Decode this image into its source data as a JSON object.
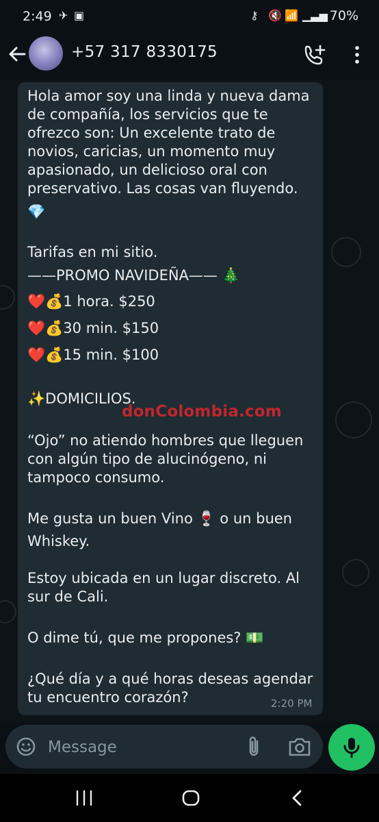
{
  "status_bar": {
    "time": "2:49",
    "battery": "70%"
  },
  "header": {
    "contact_name": "+57 317 8330175"
  },
  "message": {
    "lines": [
      "Hola amor soy una linda y nueva dama",
      "de compañía, los servicios que te",
      "ofrezco son: Un excelente trato de",
      "novios, caricias, un momento muy",
      "apasionado, un delicioso oral con",
      "preservativo. Las cosas van fluyendo.",
      "💎",
      "Tarifas en mi sitio.",
      "——PROMO NAVIDEÑA—— 🎄",
      "❤️💰1 hora.  $250",
      "❤️💰30 min. $150",
      "❤️💰15 min.  $100",
      "✨DOMICILIOS.",
      "“Ojo” no atiendo hombres que lleguen",
      "con algún tipo de alucinógeno, ni",
      "tampoco consumo.",
      "Me gusta un buen Vino 🍷 o un buen",
      "Whiskey.",
      "Estoy ubicada en un lugar discreto. Al",
      "sur de Cali.",
      "O dime tú, que me propones? 💵",
      "¿Qué día y a qué horas deseas agendar",
      "tu encuentro corazón?"
    ],
    "time": "2:20 PM"
  },
  "watermark": "donColombia.com",
  "composer": {
    "placeholder": "Message"
  },
  "colors": {
    "background": "#0b1014",
    "bubble": "#1f2c33",
    "mic_button": "#21c063",
    "watermark": "#c0272d"
  }
}
